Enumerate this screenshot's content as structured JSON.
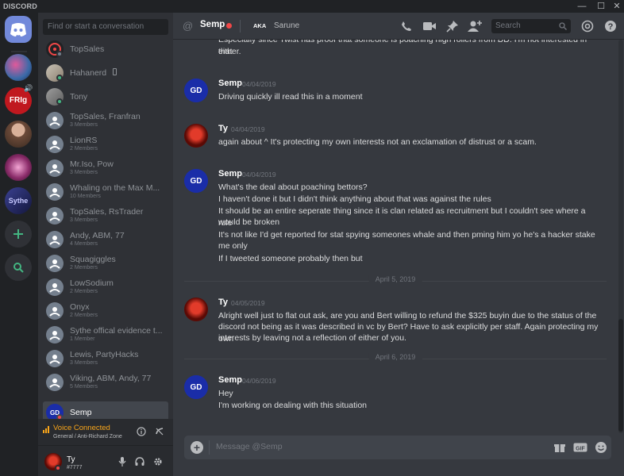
{
  "app": {
    "brand": "DISCORD"
  },
  "window": {
    "minimize": "—",
    "maximize": "☐",
    "close": "✕"
  },
  "servers": {
    "items": [
      {
        "name": "server-1",
        "color": "#3b6aa8"
      },
      {
        "name": "server-2",
        "label": "FRIg",
        "color": "#c0181f"
      },
      {
        "name": "server-3",
        "color": "#6d4b3a"
      },
      {
        "name": "server-4",
        "color": "#8c2d6b"
      },
      {
        "name": "server-5",
        "label": "Sythe",
        "color": "#2a2f6b"
      }
    ]
  },
  "dms": {
    "search_placeholder": "Find or start a conversation",
    "items": [
      {
        "name": "TopSales",
        "members": "",
        "status_color": "#747f8d"
      },
      {
        "name": "Hahanerd",
        "members": "",
        "status_color": "#43b581",
        "mobile": true
      },
      {
        "name": "Tony",
        "members": "",
        "status_color": "#43b581"
      },
      {
        "name": "TopSales, Franfran",
        "members": "3 Members"
      },
      {
        "name": "LionRS",
        "members": "2 Members"
      },
      {
        "name": "Mr.Iso, Pow",
        "members": "3 Members"
      },
      {
        "name": "Whaling on the Max M...",
        "members": "10 Members"
      },
      {
        "name": "TopSales, RsTrader",
        "members": "3 Members"
      },
      {
        "name": "Andy, ABM, 77",
        "members": "4 Members"
      },
      {
        "name": "Squagiggles",
        "members": "2 Members"
      },
      {
        "name": "LowSodium",
        "members": "2 Members"
      },
      {
        "name": "Onyx",
        "members": "2 Members"
      },
      {
        "name": "Sythe offical evidence t...",
        "members": "1 Member"
      },
      {
        "name": "Lewis, PartyHacks",
        "members": "3 Members"
      },
      {
        "name": "Viking, ABM, Andy, 77",
        "members": "5 Members"
      },
      {
        "name": "Semp",
        "members": "",
        "status_color": "#f04747",
        "selected": true
      }
    ]
  },
  "voice": {
    "title": "Voice Connected",
    "subtitle": "General / Anti-Richard Zone"
  },
  "user": {
    "name": "Ty",
    "tag": "#7777"
  },
  "header": {
    "channel": "Semp",
    "aka_label": "AKA",
    "alias": "Sarune",
    "search_placeholder": "Search"
  },
  "messages": {
    "top_text": [
      "Especially since Twist has proof that someone is poaching high rollers from DD. I'm not interested in that",
      "either."
    ],
    "groups": [
      {
        "author": "Semp",
        "timestamp": "04/04/2019",
        "lines": [
          "Driving quickly ill read this in a moment"
        ]
      },
      {
        "author": "Ty",
        "timestamp": "04/04/2019",
        "lines": [
          "again about ^ It's protecting my own interests not an exclamation of distrust or a scam."
        ]
      },
      {
        "author": "Semp",
        "timestamp": "04/04/2019",
        "lines": [
          "What's the deal about poaching bettors?",
          "I haven't done it but I didn't think anything about that was against the rules",
          "It should be an entire seperate thing since it is clan related as recruitment but I couldn't see where a rule",
          "would be broken",
          "It's not like I'd get reported for stat spying someones whale and then pming him yo he's a hacker stake",
          "me only",
          "If I tweeted someone probably then but"
        ]
      },
      {
        "author": "Ty",
        "timestamp": "04/05/2019",
        "lines": [
          "Alright well just to flat out ask, are you and Bert willing to refund the $325 buyin due to the status of the",
          "discord not being as it was described in vc by Bert?  Have to ask explicitly per staff.  Again protecting my own",
          "interests by leaving not a reflection of either of you."
        ]
      },
      {
        "author": "Semp",
        "timestamp": "04/06/2019",
        "lines": [
          "Hey",
          "I'm working on dealing with this situation"
        ]
      }
    ],
    "dividers": [
      "April 5, 2019",
      "April 6, 2019"
    ]
  },
  "composer": {
    "placeholder": "Message @Semp"
  },
  "colors": {
    "accent": "#7289da",
    "online": "#43b581",
    "dnd": "#f04747",
    "idle": "#faa61a"
  }
}
